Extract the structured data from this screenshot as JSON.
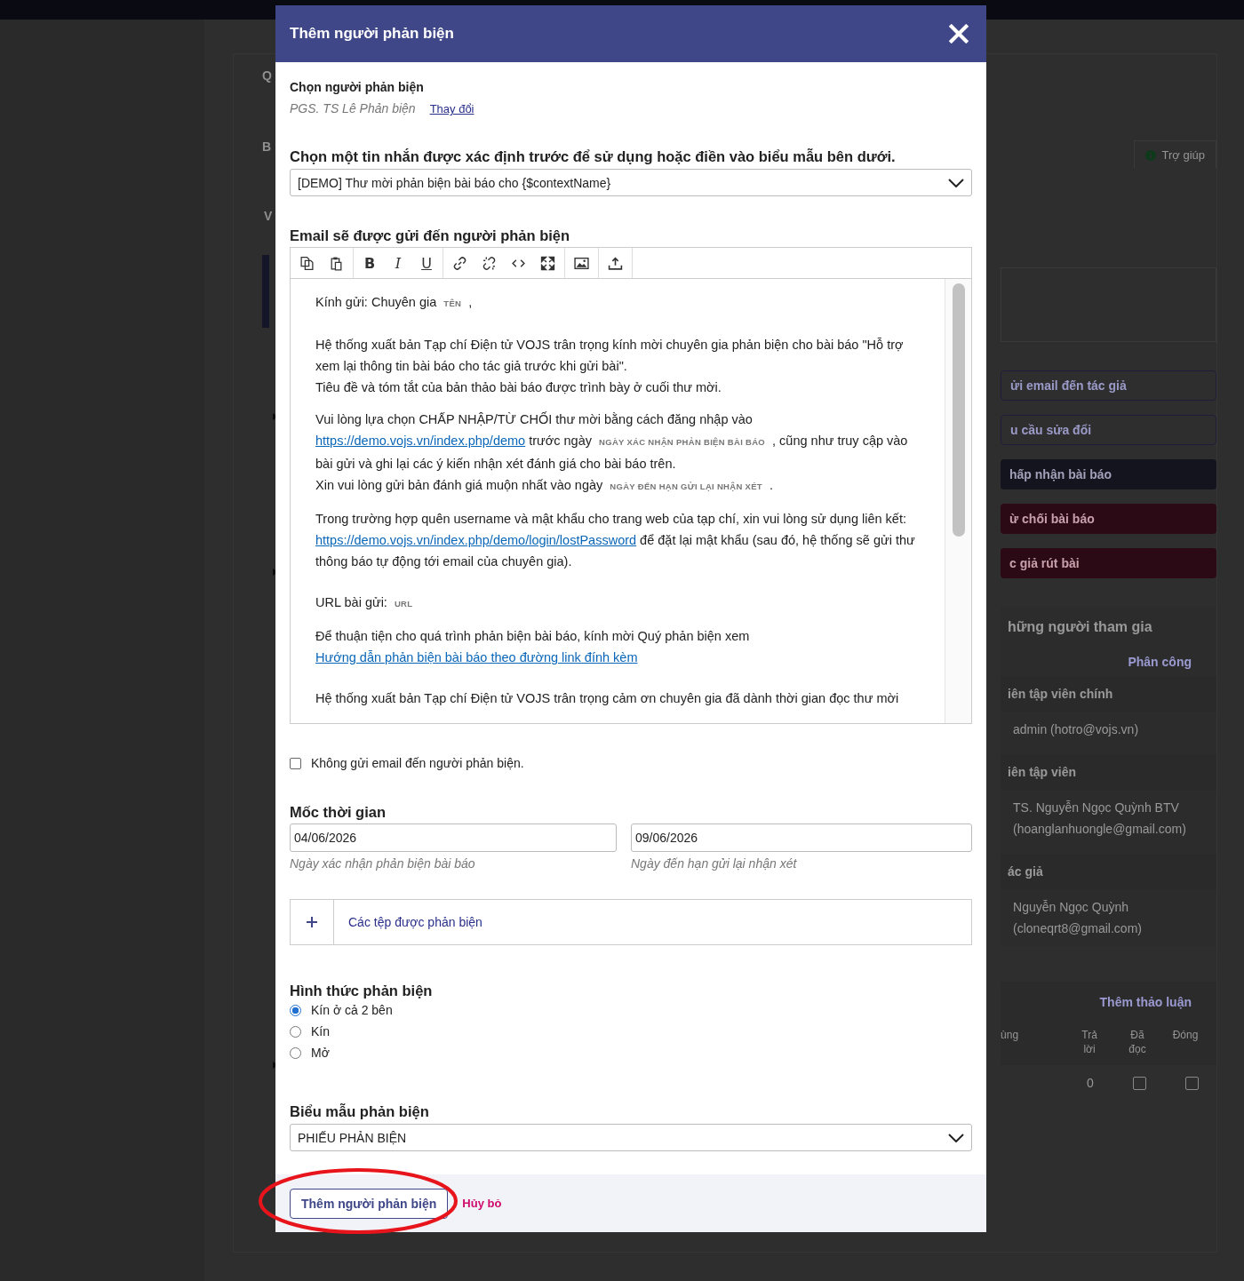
{
  "background": {
    "left_tabs": [
      "Q",
      "B",
      "V"
    ],
    "help_tab": "Trợ giúp",
    "actions": [
      {
        "label": "ửi email đến tác giả",
        "kind": "outline"
      },
      {
        "label": "u cầu sửa đổi",
        "kind": "outline"
      },
      {
        "label": "hấp nhận bài báo",
        "kind": "primary"
      },
      {
        "label": "ừ chối bài báo",
        "kind": "danger"
      },
      {
        "label": "c giả rút bài",
        "kind": "danger"
      }
    ],
    "participants": {
      "title": "hững người tham gia",
      "assign": "Phân công",
      "groups": [
        {
          "role": "iên tập viên chính",
          "members": [
            "admin (hotro@vojs.vn)"
          ]
        },
        {
          "role": "iên tập viên",
          "members": [
            "TS. Nguyễn Ngọc Quỳnh BTV (hoanglanhuongle@gmail.com)"
          ]
        },
        {
          "role": "ác giả",
          "members": [
            "Nguyễn Ngọc Quỳnh (cloneqrt8@gmail.com)"
          ]
        }
      ]
    },
    "discussions": {
      "add": "Thêm thảo luận",
      "columns": [
        "ùng",
        "Trả lời",
        "Đã đọc",
        "Đóng"
      ],
      "rows": [
        {
          "replies": "0",
          "read": false,
          "closed": false
        }
      ]
    }
  },
  "modal": {
    "title": "Thêm người phản biện",
    "reviewer": {
      "label": "Chọn người phản biện",
      "name": "PGS. TS Lê Phản biện",
      "change": "Thay đổi"
    },
    "template": {
      "label": "Chọn một tin nhắn được xác định trước để sử dụng hoặc điền vào biểu mẫu bên dưới.",
      "value": "[DEMO] Thư mời phản biện bài báo cho {$contextName}"
    },
    "email": {
      "label": "Email sẽ được gửi đến người phản biện",
      "format_buttons": [
        "B",
        "I",
        "U"
      ],
      "body": [
        {
          "spaced": false,
          "lines": [
            [
              {
                "kind": "text",
                "text": "Kính gửi: Chuyên gia "
              },
              {
                "kind": "tag",
                "text": "TÊN"
              },
              {
                "kind": "text",
                "text": " ,"
              }
            ]
          ]
        },
        {
          "spaced": true,
          "lines": [
            [
              {
                "kind": "text",
                "text": "Hệ thống xuất bản Tạp chí Điện tử VOJS trân trọng kính mời chuyên gia phản biện cho bài báo \"Hỗ trợ xem lại thông tin bài báo cho tác giả trước khi gửi bài\"."
              }
            ],
            [
              {
                "kind": "text",
                "text": "Tiêu đề và tóm tắt của bản thảo bài báo được trình bày ở cuối thư mời."
              }
            ]
          ]
        },
        {
          "spaced": false,
          "lines": [
            [
              {
                "kind": "text",
                "text": "Vui lòng lựa chọn CHẤP NHẬP/TỪ CHỐI thư mời bằng cách đăng nhập vào "
              },
              {
                "kind": "link",
                "text": "https://demo.vojs.vn/index.php/demo"
              },
              {
                "kind": "text",
                "text": " trước ngày "
              },
              {
                "kind": "tag",
                "text": "NGÀY XÁC NHẬN PHẢN BIỆN BÀI BÁO"
              },
              {
                "kind": "text",
                "text": " , cũng như truy cập vào bài gửi và ghi lại các ý kiến nhận xét đánh giá cho bài báo trên."
              }
            ],
            [
              {
                "kind": "text",
                "text": "Xin vui lòng gửi bản đánh giá muộn nhất vào ngày "
              },
              {
                "kind": "tag",
                "text": "NGÀY ĐẾN HẠN GỬI LẠI NHẬN XÉT"
              },
              {
                "kind": "text",
                "text": " ."
              }
            ]
          ]
        },
        {
          "spaced": false,
          "lines": [
            [
              {
                "kind": "text",
                "text": "Trong trường hợp quên username và mật khẩu cho trang web của tạp chí, xin vui lòng sử dụng liên kết: "
              },
              {
                "kind": "link",
                "text": "https://demo.vojs.vn/index.php/demo/login/lostPassword"
              },
              {
                "kind": "text",
                "text": " để đặt lại mật khẩu (sau đó, hệ thống sẽ gửi thư thông báo tự động tới email của chuyên gia)."
              }
            ]
          ]
        },
        {
          "spaced": true,
          "lines": [
            [
              {
                "kind": "text",
                "text": "URL bài gửi: "
              },
              {
                "kind": "tag",
                "text": "URL"
              }
            ]
          ]
        },
        {
          "spaced": false,
          "lines": [
            [
              {
                "kind": "text",
                "text": "Để thuận tiện cho quá trình phản biện bài báo, kính mời Quý phản biện xem "
              },
              {
                "kind": "link",
                "text": "Hướng dẫn phản biện bài báo theo đường link đính kèm"
              }
            ]
          ]
        },
        {
          "spaced": true,
          "lines": [
            [
              {
                "kind": "text",
                "text": "Hệ thống xuất bản Tạp chí Điện tử VOJS trân trọng cảm ơn chuyên gia đã dành thời gian đọc thư mời"
              }
            ]
          ]
        }
      ]
    },
    "skip_email": {
      "label": "Không gửi email đến người phản biện.",
      "checked": false
    },
    "dates": {
      "label": "Mốc thời gian",
      "fields": [
        {
          "value": "04/06/2026",
          "hint": "Ngày xác nhận phản biện bài báo"
        },
        {
          "value": "09/06/2026",
          "hint": "Ngày đến hạn gửi lại nhận xét"
        }
      ]
    },
    "files": {
      "label": "Các tệp được phản biện"
    },
    "review_type": {
      "label": "Hình thức phản biện",
      "options": [
        {
          "label": "Kín ở cả 2 bên",
          "selected": true
        },
        {
          "label": "Kín",
          "selected": false
        },
        {
          "label": "Mở",
          "selected": false
        }
      ]
    },
    "form": {
      "label": "Biểu mẫu phản biện",
      "value": "PHIẾU PHẢN BIỆN"
    },
    "buttons": {
      "submit": "Thêm người phản biện",
      "cancel": "Hủy bỏ"
    }
  }
}
